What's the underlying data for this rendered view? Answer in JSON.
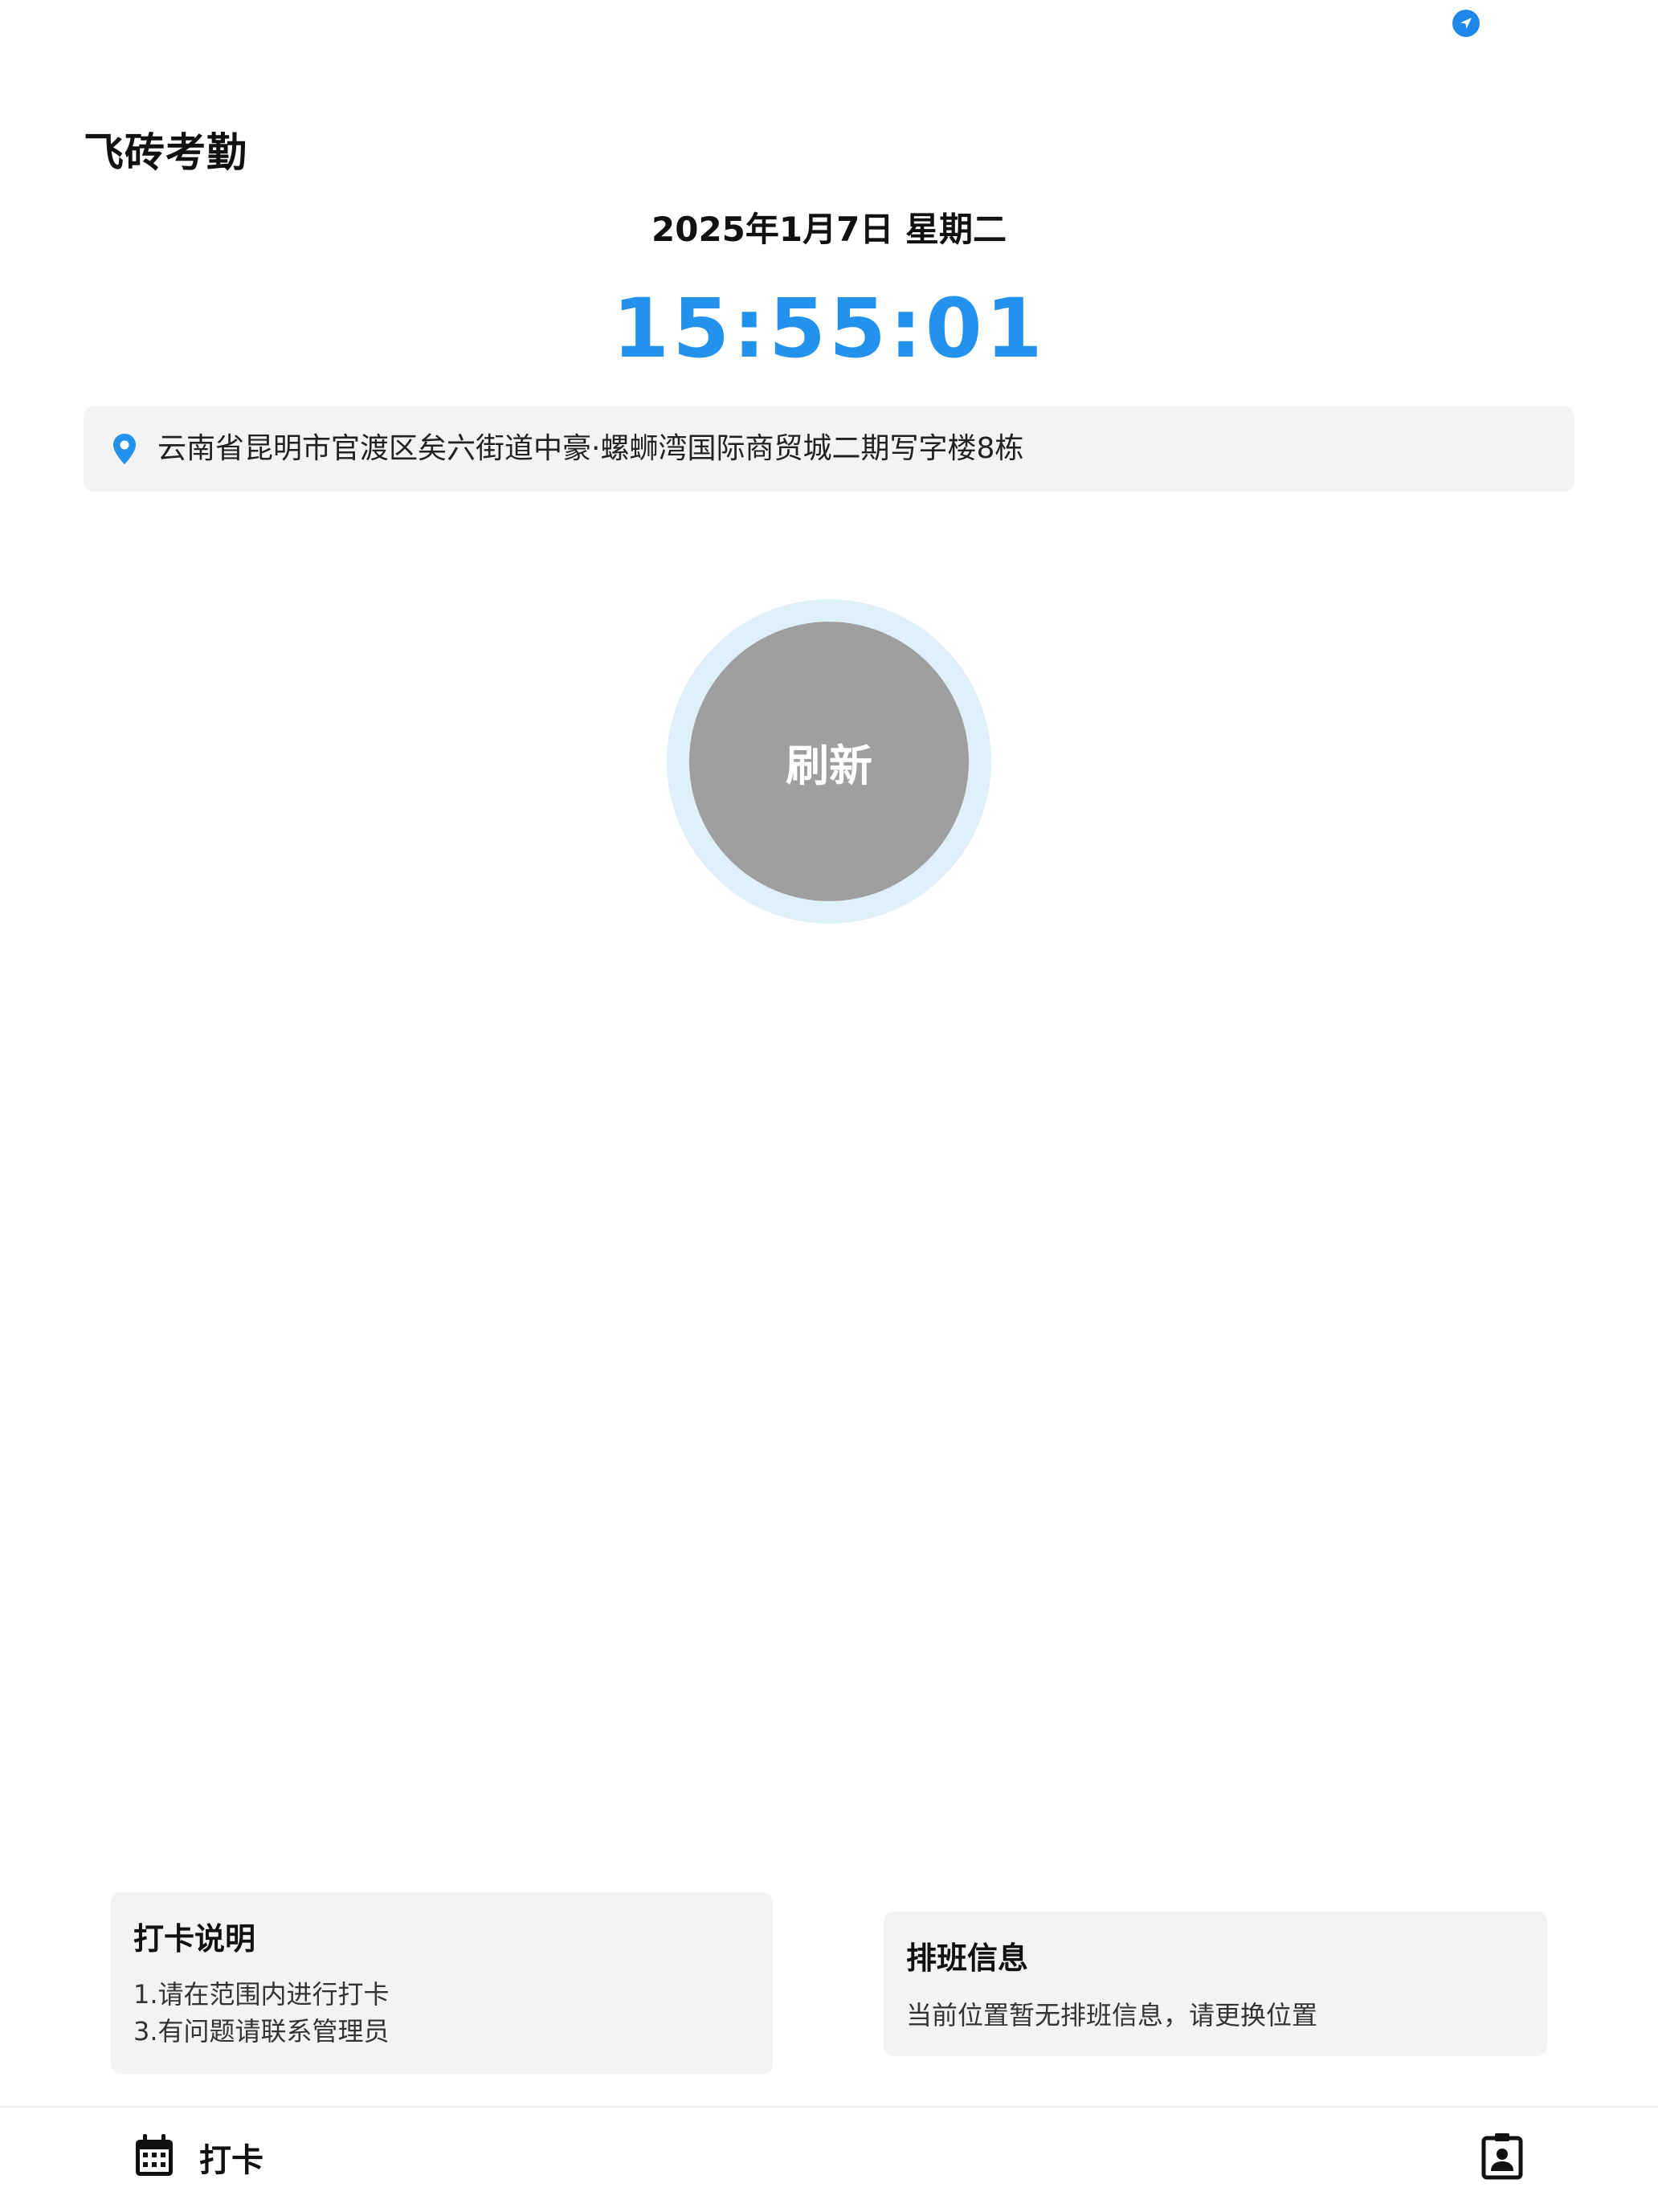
{
  "header": {
    "app_title": "飞砖考勤"
  },
  "datetime": {
    "date": "2025年1月7日 星期二",
    "time": "15:55:01"
  },
  "location": {
    "address": "云南省昆明市官渡区矣六街道中豪·螺蛳湾国际商贸城二期写字楼8栋",
    "icon": "map-pin-icon"
  },
  "refresh": {
    "label": "刷新"
  },
  "instructions": {
    "title": "打卡说明",
    "lines": [
      "1.请在范围内进行打卡",
      "3.有问题请联系管理员"
    ]
  },
  "schedule": {
    "title": "排班信息",
    "message": "当前位置暂无排班信息，请更换位置"
  },
  "tabbar": {
    "checkin_label": "打卡",
    "checkin_icon": "calendar-icon",
    "profile_icon": "profile-badge-icon"
  },
  "colors": {
    "accent": "#2392ec",
    "refresh_button": "#9f9f9f",
    "refresh_ring": "#e0f0f8",
    "card_bg": "#f3f3f3"
  }
}
